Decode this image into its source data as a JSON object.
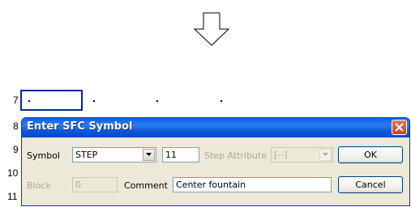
{
  "background": {
    "row_numbers": [
      "7",
      "8",
      "9",
      "10",
      "11"
    ],
    "arrow_icon": "down-arrow-icon"
  },
  "dialog": {
    "title": "Enter SFC Symbol",
    "close_icon": "close-icon",
    "symbol_label": "Symbol",
    "symbol_value": "STEP",
    "step_number_value": "11",
    "step_attribute_label": "Step Attribute",
    "step_attribute_value": "[--]",
    "block_label": "Block",
    "block_value": "0",
    "comment_label": "Comment",
    "comment_value": "Center fountain",
    "ok_label": "OK",
    "cancel_label": "Cancel"
  },
  "colors": {
    "title_bar": "#0a5fe8",
    "dialog_face": "#ece9d8",
    "selection_border": "#0a24a0",
    "close_button": "#d9542d"
  }
}
